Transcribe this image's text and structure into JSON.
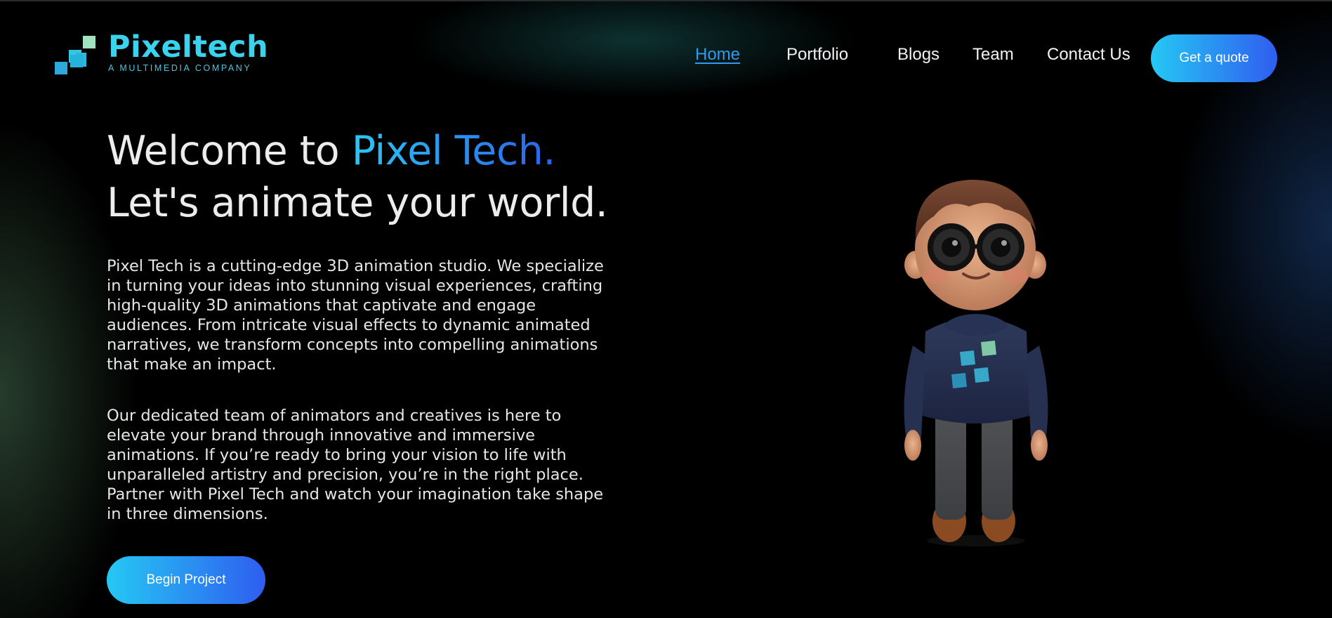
{
  "brand": {
    "name": "Pixeltech",
    "tagline": "A MULTIMEDIA COMPANY"
  },
  "nav": {
    "items": [
      {
        "label": "Home",
        "active": true
      },
      {
        "label": "Portfolio",
        "active": false
      },
      {
        "label": "Blogs",
        "active": false
      },
      {
        "label": "Team",
        "active": false
      },
      {
        "label": "Contact Us",
        "active": false
      }
    ],
    "cta_label": "Get a quote"
  },
  "hero": {
    "title_prefix": "Welcome to ",
    "title_accent": "Pixel Tech.",
    "title_line2": "Let's animate your world.",
    "paragraph1": "Pixel Tech is a cutting-edge 3D animation studio. We specialize in turning your ideas into stunning visual experiences, crafting high-quality 3D animations that captivate and engage audiences. From intricate visual effects to dynamic animated narratives, we transform concepts into compelling animations that make an impact.",
    "paragraph2": "Our dedicated team of animators and creatives is here to elevate your brand through innovative and immersive animations. If you’re ready to bring your vision to life with unparalleled artistry and precision, you’re in the right place. Partner with Pixel Tech and watch your imagination take shape in three dimensions.",
    "cta_label": "Begin Project"
  },
  "colors": {
    "brand_cyan": "#3ad3ee",
    "accent_blue": "#2f9bf0",
    "button_gradient_start": "#25c8f4",
    "button_gradient_end": "#2f5df0",
    "background": "#000000"
  },
  "icons": {
    "logo_mark": "pixel-squares-logo-icon",
    "character": "3d-character-illustration"
  }
}
